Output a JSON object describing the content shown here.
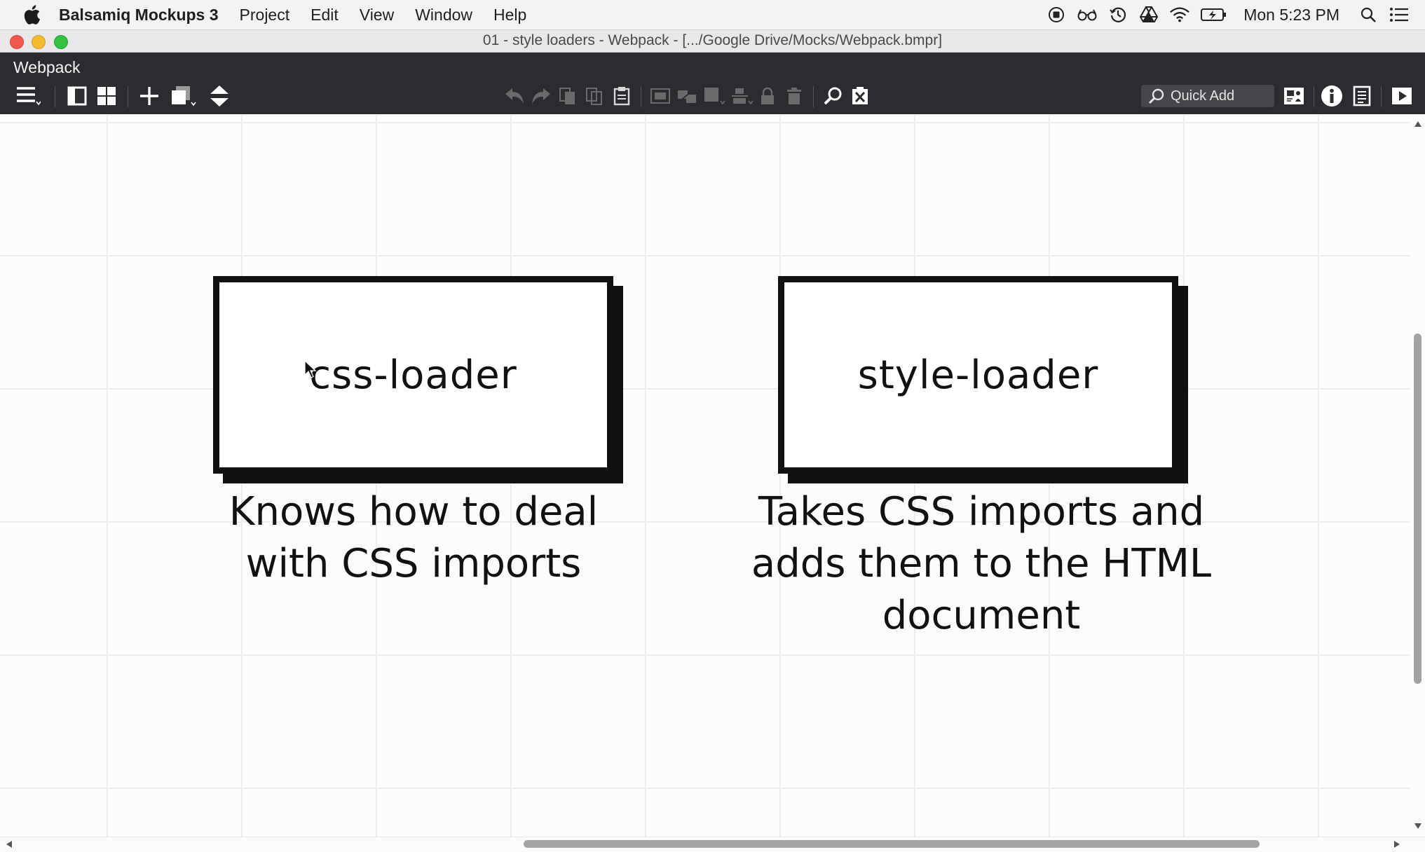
{
  "menubar": {
    "apple_icon": "apple-logo-icon",
    "app_name": "Balsamiq Mockups 3",
    "items": [
      "Project",
      "Edit",
      "View",
      "Window",
      "Help"
    ],
    "clock": "Mon 5:23 PM",
    "status_icons": [
      "record-icon",
      "glasses-icon",
      "time-machine-icon",
      "google-drive-icon",
      "wifi-icon",
      "battery-icon",
      "spotlight-search-icon",
      "notification-center-icon"
    ]
  },
  "window": {
    "title": "01 - style loaders - Webpack - [.../Google Drive/Mocks/Webpack.bmpr]"
  },
  "toolbar": {
    "project_name": "Webpack",
    "quick_add_placeholder": "Quick Add",
    "icons": [
      "hamburger-menu-icon",
      "single-panel-icon",
      "grid-view-icon",
      "add-icon",
      "duplicate-icon",
      "sort-icon",
      "undo-icon",
      "redo-icon",
      "copy-icon",
      "cut-icon",
      "paste-icon",
      "group-icon",
      "ungroup-icon",
      "bring-to-front-icon",
      "align-icon",
      "lock-icon",
      "delete-icon",
      "zoom-icon",
      "clear-icon",
      "search-icon",
      "presentation-view-icon",
      "info-icon",
      "notes-icon",
      "play-icon"
    ]
  },
  "canvas": {
    "boxes": [
      {
        "label": "css-loader",
        "caption": [
          "Knows how to deal",
          "with CSS imports"
        ]
      },
      {
        "label": "style-loader",
        "caption": [
          "Takes CSS imports and",
          "adds them to the HTML",
          "document"
        ]
      }
    ]
  }
}
